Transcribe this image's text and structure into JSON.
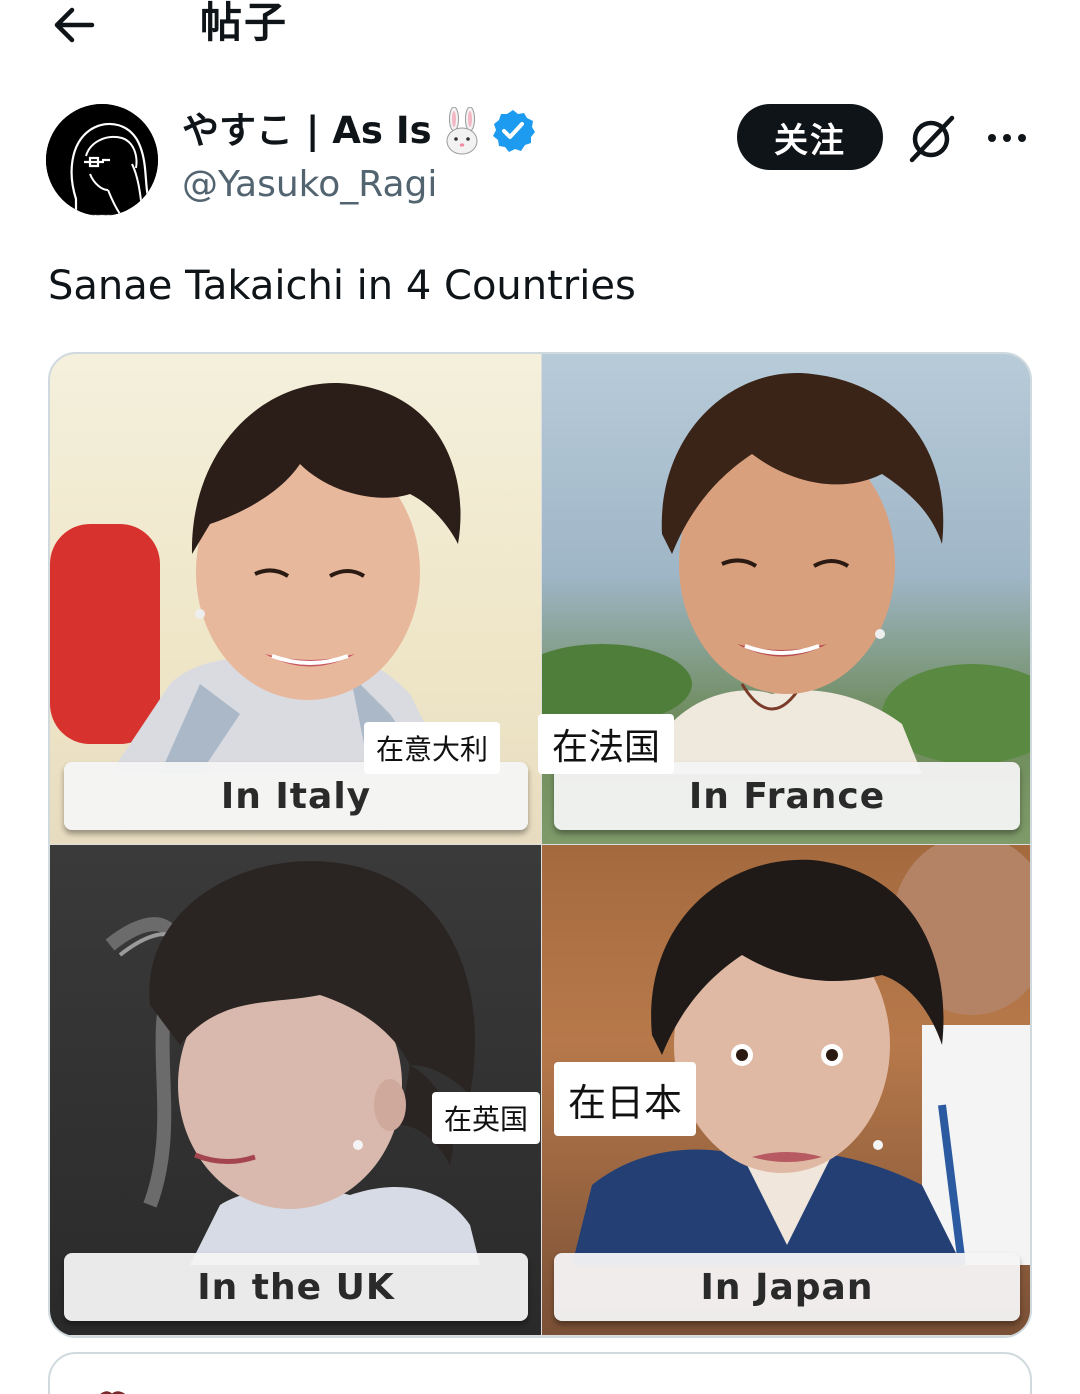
{
  "header": {
    "title": "帖子"
  },
  "author": {
    "display_name": "やすこ | As Is",
    "handle": "@Yasuko_Ragi",
    "verified": true,
    "emoji": "rabbit"
  },
  "actions": {
    "follow_label": "关注"
  },
  "tweet": {
    "text": "Sanae Takaichi in 4 Countries"
  },
  "media": {
    "panels": [
      {
        "caption": "In Italy",
        "zh_label": "在意大利"
      },
      {
        "caption": "In France",
        "zh_label": "在法国"
      },
      {
        "caption": "In the UK",
        "zh_label": "在英国"
      },
      {
        "caption": "In Japan",
        "zh_label": "在日本"
      }
    ]
  },
  "colors": {
    "verified_blue": "#1d9bf0",
    "follow_bg": "#0f1419",
    "handle_gray": "#536471",
    "border": "#cfd9de"
  },
  "icons": [
    "back-arrow-icon",
    "rabbit-icon",
    "verified-badge-icon",
    "grok-icon",
    "more-icon"
  ]
}
